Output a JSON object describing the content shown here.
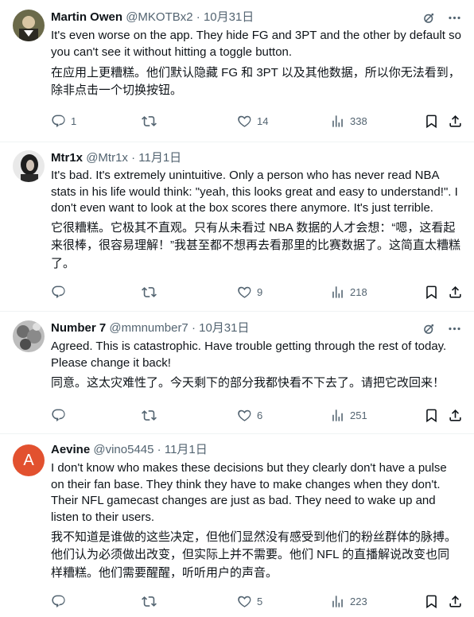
{
  "tweets": [
    {
      "name": "Martin Owen",
      "handle": "@MKOTBx2",
      "dot": "·",
      "date": "10月31日",
      "text": "It's even worse on the app. They hide FG and 3PT and the other by default so you can't see it without hitting a toggle button.",
      "translation": "在应用上更糟糕。他们默认隐藏 FG 和 3PT 以及其他数据，所以你无法看到，除非点击一个切换按钮。",
      "replies": "1",
      "retweets": "",
      "likes": "14",
      "views": "338"
    },
    {
      "name": "Mtr1x",
      "handle": "@Mtr1x",
      "dot": "·",
      "date": "11月1日",
      "text": "It's bad. It's extremely unintuitive. Only a person who has never read NBA stats in his life would think: \"yeah, this looks great and easy to understand!\". I don't even want to look at the box scores there anymore. It's just terrible.",
      "translation": "它很糟糕。它极其不直观。只有从未看过 NBA 数据的人才会想：“嗯，这看起来很棒，很容易理解！”我甚至都不想再去看那里的比赛数据了。这简直太糟糕了。",
      "replies": "",
      "retweets": "",
      "likes": "9",
      "views": "218"
    },
    {
      "name": "Number 7",
      "handle": "@mmnumber7",
      "dot": "·",
      "date": "10月31日",
      "text": "Agreed.  This is catastrophic. Have trouble getting through the rest of today. Please change it back!",
      "translation": "同意。这太灾难性了。今天剩下的部分我都快看不下去了。请把它改回来！",
      "replies": "",
      "retweets": "",
      "likes": "6",
      "views": "251"
    },
    {
      "name": "Aevine",
      "handle": "@vino5445",
      "dot": "·",
      "date": "11月1日",
      "avatar_letter": "A",
      "text": "I don't know who makes these decisions but they clearly don't have a pulse on their fan base.  They think they have to make changes when they don't.  Their NFL gamecast changes are just as bad.  They need to wake up and listen to their users.",
      "translation": "我不知道是谁做的这些决定，但他们显然没有感受到他们的粉丝群体的脉搏。他们认为必须做出改变，但实际上并不需要。他们 NFL 的直播解说改变也同样糟糕。他们需要醒醒，听听用户的声音。",
      "replies": "",
      "retweets": "",
      "likes": "5",
      "views": "223"
    }
  ],
  "icons": {
    "grok": "grok-icon",
    "more": "more-icon",
    "reply": "reply-icon",
    "retweet": "retweet-icon",
    "like": "like-icon",
    "views": "views-icon",
    "bookmark": "bookmark-icon",
    "share": "share-icon"
  },
  "colors": {
    "text": "#0f1419",
    "muted": "#536471",
    "divider": "#eff3f4",
    "avatar_letter_bg": "#e2512f"
  }
}
